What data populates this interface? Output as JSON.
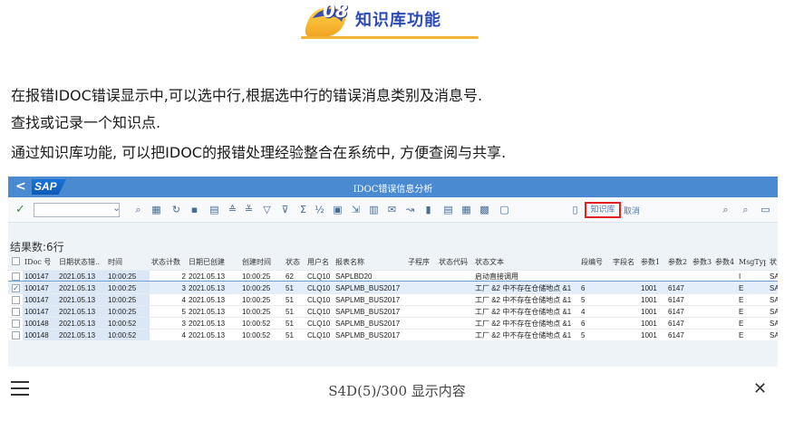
{
  "section": {
    "number": "08",
    "title": "知识库功能"
  },
  "paragraphs": [
    "在报错IDOC错误显示中,可以选中行,根据选中行的错误消息类别及消息号.",
    "查找或记录一个知识点.",
    "通过知识库功能, 可以把IDOC的报错处理经验整合在系统中, 方便查阅与共享."
  ],
  "sap": {
    "back": "<",
    "logo": "SAP",
    "title": "IDOC错误信息分析",
    "toolbar": {
      "check": "✓",
      "dropdown": "⌄",
      "knowledge_btn": "知识库",
      "cancel_btn": "取消"
    },
    "result_count": "结果数:6行",
    "headers": [
      "IDoc 号",
      "日期状态错..",
      "时间",
      "状态计数",
      "日期已创建",
      "创建时间",
      "状态",
      "用户名",
      "报表名称",
      "子程序",
      "状态代码",
      "状态文本",
      "段编号",
      "字段名",
      "参数1",
      "参数2",
      "参数3",
      "参数4",
      "MsgTyp",
      "状"
    ],
    "rows": [
      {
        "sel": false,
        "cells": [
          "100147",
          "2021.05.13",
          "10:00:25",
          "2",
          "2021.05.13",
          "10:00:25",
          "62",
          "CLQ10",
          "SAPLBD20",
          "",
          "",
          "启动直接调用",
          "",
          "",
          "",
          "",
          "",
          "",
          "I",
          "SA"
        ]
      },
      {
        "sel": true,
        "cells": [
          "100147",
          "2021.05.13",
          "10:00:25",
          "3",
          "2021.05.13",
          "10:00:25",
          "51",
          "CLQ10",
          "SAPLMB_BUS2017",
          "",
          "",
          "工厂 &2 中不存在仓储地点 &1",
          "6",
          "",
          "1001",
          "6147",
          "",
          "",
          "E",
          "SA"
        ]
      },
      {
        "sel": false,
        "cells": [
          "100147",
          "2021.05.13",
          "10:00:25",
          "4",
          "2021.05.13",
          "10:00:25",
          "51",
          "CLQ10",
          "SAPLMB_BUS2017",
          "",
          "",
          "工厂 &2 中不存在仓储地点 &1",
          "5",
          "",
          "1001",
          "6147",
          "",
          "",
          "E",
          "SA"
        ]
      },
      {
        "sel": false,
        "cells": [
          "100147",
          "2021.05.13",
          "10:00:25",
          "5",
          "2021.05.13",
          "10:00:25",
          "51",
          "CLQ10",
          "SAPLMB_BUS2017",
          "",
          "",
          "工厂 &2 中不存在仓储地点 &1",
          "4",
          "",
          "1001",
          "6147",
          "",
          "",
          "E",
          "SA"
        ]
      },
      {
        "sel": false,
        "cells": [
          "100148",
          "2021.05.13",
          "10:00:52",
          "3",
          "2021.05.13",
          "10:00:52",
          "51",
          "CLQ10",
          "SAPLMB_BUS2017",
          "",
          "",
          "工厂 &2 中不存在仓储地点 &1",
          "6",
          "",
          "1001",
          "6147",
          "",
          "",
          "E",
          "SA"
        ]
      },
      {
        "sel": false,
        "cells": [
          "100148",
          "2021.05.13",
          "10:00:52",
          "4",
          "2021.05.13",
          "10:00:52",
          "51",
          "CLQ10",
          "SAPLMB_BUS2017",
          "",
          "",
          "工厂 &2 中不存在仓储地点 &1",
          "5",
          "",
          "1001",
          "6147",
          "",
          "",
          "E",
          "SA"
        ]
      }
    ]
  },
  "bottom": {
    "title": "S4D(5)/300 显示内容",
    "close": "✕"
  },
  "colors": {
    "accent": "#2b4bb3",
    "sap_bar": "#4a8ad0",
    "highlight": "#e02020"
  }
}
